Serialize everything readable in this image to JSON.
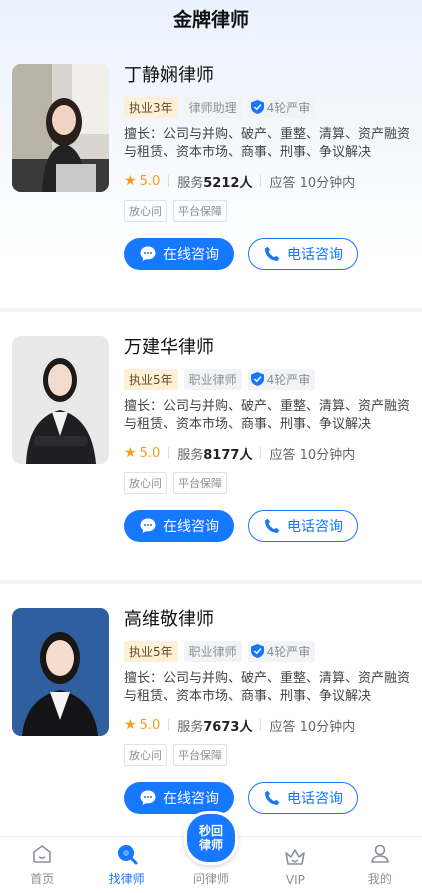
{
  "header": {
    "title": "金牌律师"
  },
  "lawyers": [
    {
      "name": "丁静娴律师",
      "experience": "执业3年",
      "role": "律师助理",
      "review": "4轮严审",
      "expertise": "擅长：公司与并购、破产、重整、清算、资产融资与租赁、资本市场、商事、刑事、争议解决",
      "rating": "5.0",
      "served_label": "服务",
      "served_count": "5212人",
      "response": "应答 10分钟内",
      "badges": [
        "放心问",
        "平台保障"
      ],
      "online_label": "在线咨询",
      "phone_label": "电话咨询"
    },
    {
      "name": "万建华律师",
      "experience": "执业5年",
      "role": "职业律师",
      "review": "4轮严审",
      "expertise": "擅长：公司与并购、破产、重整、清算、资产融资与租赁、资本市场、商事、刑事、争议解决",
      "rating": "5.0",
      "served_label": "服务",
      "served_count": "8177人",
      "response": "应答 10分钟内",
      "badges": [
        "放心问",
        "平台保障"
      ],
      "online_label": "在线咨询",
      "phone_label": "电话咨询"
    },
    {
      "name": "高维敬律师",
      "experience": "执业5年",
      "role": "职业律师",
      "review": "4轮严审",
      "expertise": "擅长：公司与并购、破产、重整、清算、资产融资与租赁、资本市场、商事、刑事、争议解决",
      "rating": "5.0",
      "served_label": "服务",
      "served_count": "7673人",
      "response": "应答 10分钟内",
      "badges": [
        "放心问",
        "平台保障"
      ],
      "online_label": "在线咨询",
      "phone_label": "电话咨询"
    }
  ],
  "tabbar": {
    "home": "首页",
    "find": "找律师",
    "ask": "问律师",
    "vip": "VIP",
    "mine": "我的",
    "bubble_line1": "秒回",
    "bubble_line2": "律师"
  },
  "colors": {
    "accent": "#1677ff",
    "rating": "#f79a1a",
    "exp_tag_bg": "#fdf0d9"
  }
}
